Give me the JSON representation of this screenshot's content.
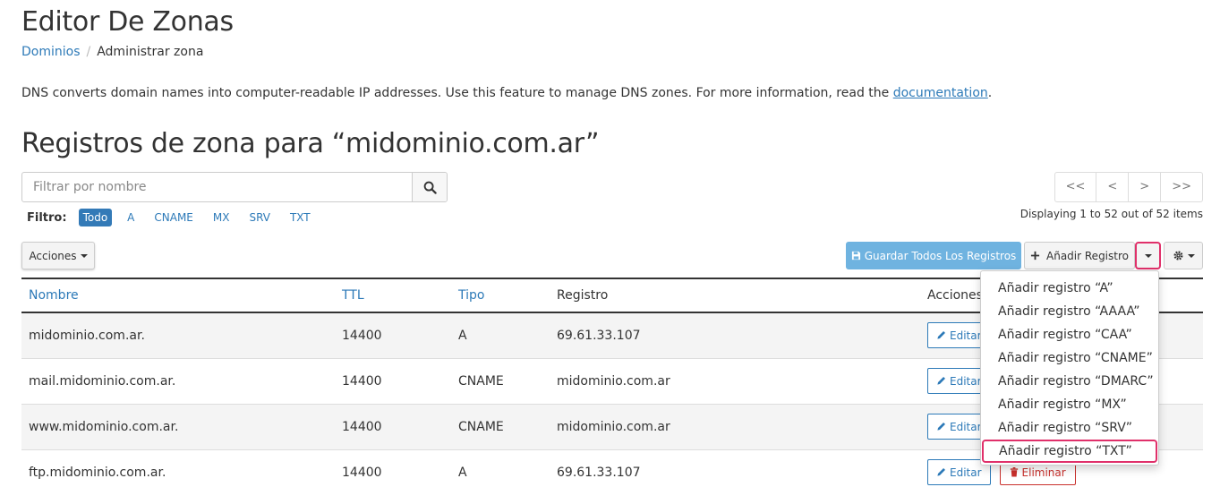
{
  "page": {
    "title": "Editor De Zonas",
    "breadcrumb": [
      "Dominios",
      "Administrar zona"
    ],
    "description": "DNS converts domain names into computer-readable IP addresses. Use this feature to manage DNS zones. For more information, read the ",
    "doc_link": "documentation",
    "desc_end": ".",
    "zone_title": "Registros de zona para “midominio.com.ar”"
  },
  "search": {
    "placeholder": "Filtrar por nombre"
  },
  "filter": {
    "label": "Filtro:",
    "items": [
      "Todo",
      "A",
      "CNAME",
      "MX",
      "SRV",
      "TXT"
    ],
    "active": "Todo"
  },
  "pager": {
    "first": "<<",
    "prev": "<",
    "next": ">",
    "last": ">>",
    "status": "Displaying 1 to 52 out of 52 items"
  },
  "toolbar": {
    "acciones": "Acciones",
    "guardar": "Guardar Todos Los Registros",
    "anadir": "Añadir Registro"
  },
  "table": {
    "headers": [
      "Nombre",
      "TTL",
      "Tipo",
      "Registro",
      "Acciones"
    ],
    "rows": [
      {
        "name": "midominio.com.ar.",
        "ttl": "14400",
        "type": "A",
        "record": "69.61.33.107"
      },
      {
        "name": "mail.midominio.com.ar.",
        "ttl": "14400",
        "type": "CNAME",
        "record": "midominio.com.ar"
      },
      {
        "name": "www.midominio.com.ar.",
        "ttl": "14400",
        "type": "CNAME",
        "record": "midominio.com.ar"
      },
      {
        "name": "ftp.midominio.com.ar.",
        "ttl": "14400",
        "type": "A",
        "record": "69.61.33.107"
      }
    ],
    "edit_label": "Editar",
    "delete_label": "Eliminar"
  },
  "dropdown": {
    "items": [
      "Añadir registro “A”",
      "Añadir registro “AAAA”",
      "Añadir registro “CAA”",
      "Añadir registro “CNAME”",
      "Añadir registro “DMARC”",
      "Añadir registro “MX”",
      "Añadir registro “SRV”",
      "Añadir registro “TXT”"
    ],
    "highlighted": "Añadir registro “TXT”"
  },
  "colors": {
    "link": "#2d7ab8",
    "primary": "#6fb3e0",
    "danger": "#c9302c",
    "highlight": "#e0306a"
  }
}
